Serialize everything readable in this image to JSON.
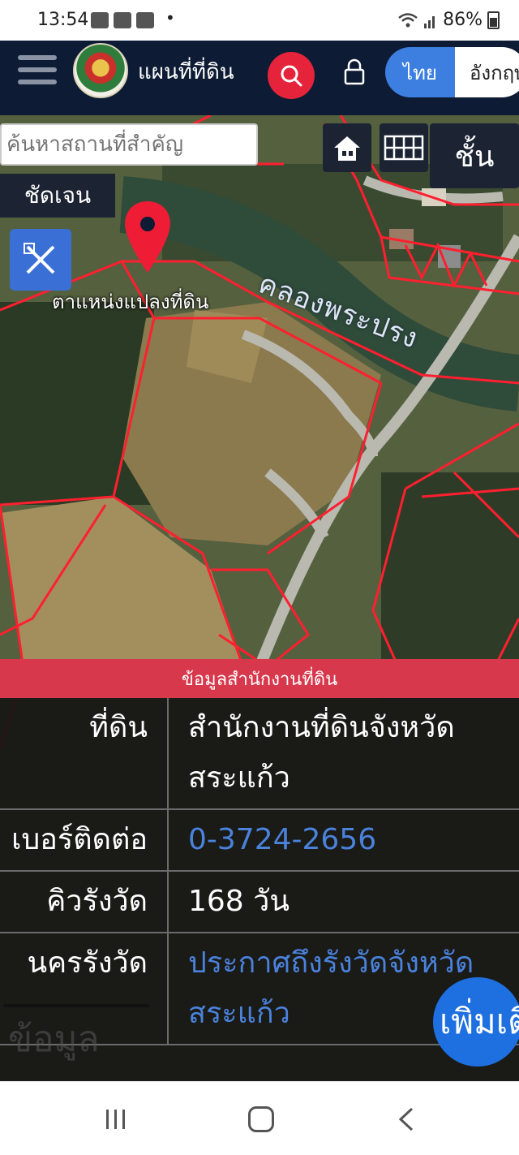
{
  "status_bar": {
    "time": "13:54",
    "dot": "•",
    "battery": "86%"
  },
  "header": {
    "title": "แผนที่ที่ดิน",
    "lang_active": "ไทย",
    "lang_other": "อังกฤษ"
  },
  "map": {
    "search_placeholder": "ค้นหาสถานที่สำคัญ",
    "clear_label": "ชัดเจน",
    "layer_label": "ชั้น",
    "pin_label": "ตาแหน่งแปลงที่ดิน",
    "canal_label": "คลองพระปรง"
  },
  "info": {
    "header": "ข้อมูลสำนักงานที่ดิน",
    "rows": [
      {
        "key": "ที่ดิน",
        "value": "สำนักงานที่ดินจังหวัดสระแก้ว",
        "link": false
      },
      {
        "key": "เบอร์ติดต่อ",
        "value": "0-3724-2656",
        "link": true
      },
      {
        "key": "คิวรังวัด",
        "value": "168 วัน",
        "link": false
      },
      {
        "key": "นครรังวัด",
        "value": "ประกาศถึงรังวัดจังหวัดสระแก้ว",
        "link": true
      }
    ],
    "ghost_text": "ข้อมูล",
    "more_button": "เพิ่มเติม"
  },
  "colors": {
    "appbar_bg": "#0d1b34",
    "accent_red": "#e5243b",
    "lang_blue": "#3d7fe0",
    "link_blue": "#4a82dc",
    "parcel_line": "#ff1f2f"
  }
}
